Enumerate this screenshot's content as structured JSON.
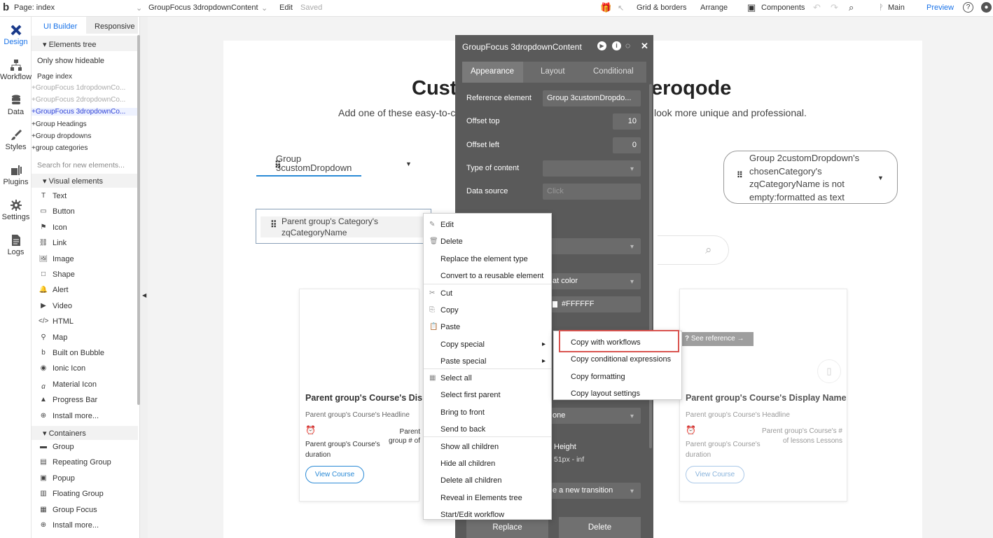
{
  "topbar": {
    "page_label": "Page: index",
    "element_select": "GroupFocus 3dropdownContent",
    "edit": "Edit",
    "saved": "Saved",
    "grid_borders": "Grid & borders",
    "arrange": "Arrange",
    "components": "Components",
    "branch": "Main",
    "preview": "Preview"
  },
  "rail": [
    {
      "label": "Design",
      "icon": "design-icon"
    },
    {
      "label": "Workflow",
      "icon": "workflow-icon"
    },
    {
      "label": "Data",
      "icon": "database-icon"
    },
    {
      "label": "Styles",
      "icon": "brush-icon"
    },
    {
      "label": "Plugins",
      "icon": "plugin-icon"
    },
    {
      "label": "Settings",
      "icon": "gear-icon"
    },
    {
      "label": "Logs",
      "icon": "document-icon"
    }
  ],
  "panel": {
    "tabs": [
      "UI Builder",
      "Responsive"
    ],
    "elements_tree": "Elements tree",
    "only_show_hideable": "Only show hideable",
    "page_index": "Page index",
    "tree_items": [
      "GroupFocus 1dropdownCo...",
      "GroupFocus 2dropdownCo...",
      "GroupFocus 3dropdownCo...",
      "Group Headings",
      "Group dropdowns",
      "group categories"
    ],
    "search_placeholder": "Search for new elements...",
    "visual_elements": "Visual elements",
    "visual_items": [
      "Text",
      "Button",
      "Icon",
      "Link",
      "Image",
      "Shape",
      "Alert",
      "Video",
      "HTML",
      "Map",
      "Built on Bubble",
      "Ionic Icon",
      "Material Icon",
      "Progress Bar",
      "Install more..."
    ],
    "containers": "Containers",
    "container_items": [
      "Group",
      "Repeating Group",
      "Popup",
      "Floating Group",
      "Group Focus",
      "Install more..."
    ]
  },
  "canvas": {
    "heading_left": "Cust",
    "heading_right": "eroqode",
    "sub_left": "Add one of these easy-to-c",
    "sub_right": "look more unique and professional.",
    "dropdown1": "Group 3customDropdown",
    "dropdown2": "Group 2customDropdown's chosenCategory's zqCategoryName is not empty:formatted as text",
    "selected_text": "Parent group's Category's zqCategoryName",
    "card_left": {
      "title": "Parent group's Course's Displa",
      "headline": "Parent group's Course's Headline",
      "duration": "Parent group's Course's duration",
      "lessons": "Parent group # of lesso",
      "button": "View Course"
    },
    "card_right": {
      "title": "Parent group's Course's Display Name",
      "headline": "Parent group's Course's Headline",
      "duration": "Parent group's Course's duration",
      "lessons": "Parent group's Course's # of lessons Lessons",
      "button": "View Course"
    },
    "see_reference": "See reference →"
  },
  "editor": {
    "title": "GroupFocus 3dropdownContent",
    "tabs": [
      "Appearance",
      "Layout",
      "Conditional"
    ],
    "ref_label": "Reference element",
    "ref_value": "Group 3customDropdo...",
    "offset_top_label": "Offset top",
    "offset_top": "10",
    "offset_left_label": "Offset left",
    "offset_left": "0",
    "type_label": "Type of content",
    "source_label": "Data source",
    "source_placeholder": "Click",
    "style_value": "at color",
    "color_value": "#FFFFFF",
    "none_value": "one",
    "height_label": "Height",
    "height_value": "51px - inf",
    "transition_value": "e a new transition",
    "replace": "Replace",
    "delete": "Delete"
  },
  "context_menu": [
    "Edit",
    "Delete",
    "Replace the element type",
    "Convert to a reusable element",
    "Cut",
    "Copy",
    "Paste",
    "Copy special",
    "Paste special",
    "Select all",
    "Select first parent",
    "Bring to front",
    "Send to back",
    "Show all children",
    "Hide all children",
    "Delete all children",
    "Reveal in Elements tree",
    "Start/Edit workflow"
  ],
  "submenu": [
    "Copy with workflows",
    "Copy conditional expressions",
    "Copy formatting",
    "Copy layout settings"
  ],
  "colors": {
    "accent": "#1a73e8",
    "highlight": "#d9534f",
    "editor_bg": "#5a5a5a"
  }
}
